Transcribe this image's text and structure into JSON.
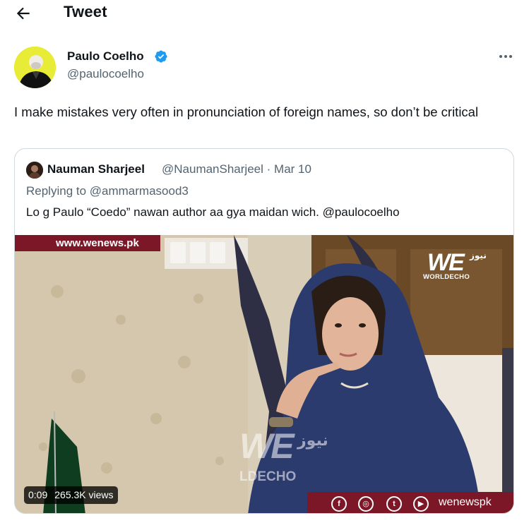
{
  "header": {
    "title": "Tweet",
    "back_icon": "arrow-left-icon"
  },
  "tweet": {
    "author_name": "Paulo Coelho",
    "author_handle": "@paulocoelho",
    "verified": true,
    "text": "I make mistakes very often in pronunciation of foreign names, so don’t be critical"
  },
  "quote": {
    "author_name": "Nauman Sharjeel",
    "author_handle": "@NaumanSharjeel",
    "separator": "·",
    "date": "Mar 10",
    "replying_to": "Replying to @ammarmasood3",
    "text": "Lo g Paulo “Coedo” nawan author aa gya maidan wich. @paulocoelho"
  },
  "video": {
    "site_banner": "www.wenews.pk",
    "logo_main": "WE",
    "logo_urdu": "نیوز",
    "logo_sub": "WORLDECHO",
    "watermark_main": "WE",
    "watermark_urdu": "نیوز",
    "watermark_sub": "LDECHO",
    "social_label": "wenewspk",
    "social_icons": [
      "facebook-icon",
      "instagram-icon",
      "twitter-icon",
      "youtube-icon"
    ],
    "duration": "0:09",
    "views": "265.3K views"
  },
  "colors": {
    "verified_blue": "#1d9bf0",
    "brand_maroon": "#7b1727",
    "secondary_text": "#536471",
    "border": "#cfd9de"
  }
}
